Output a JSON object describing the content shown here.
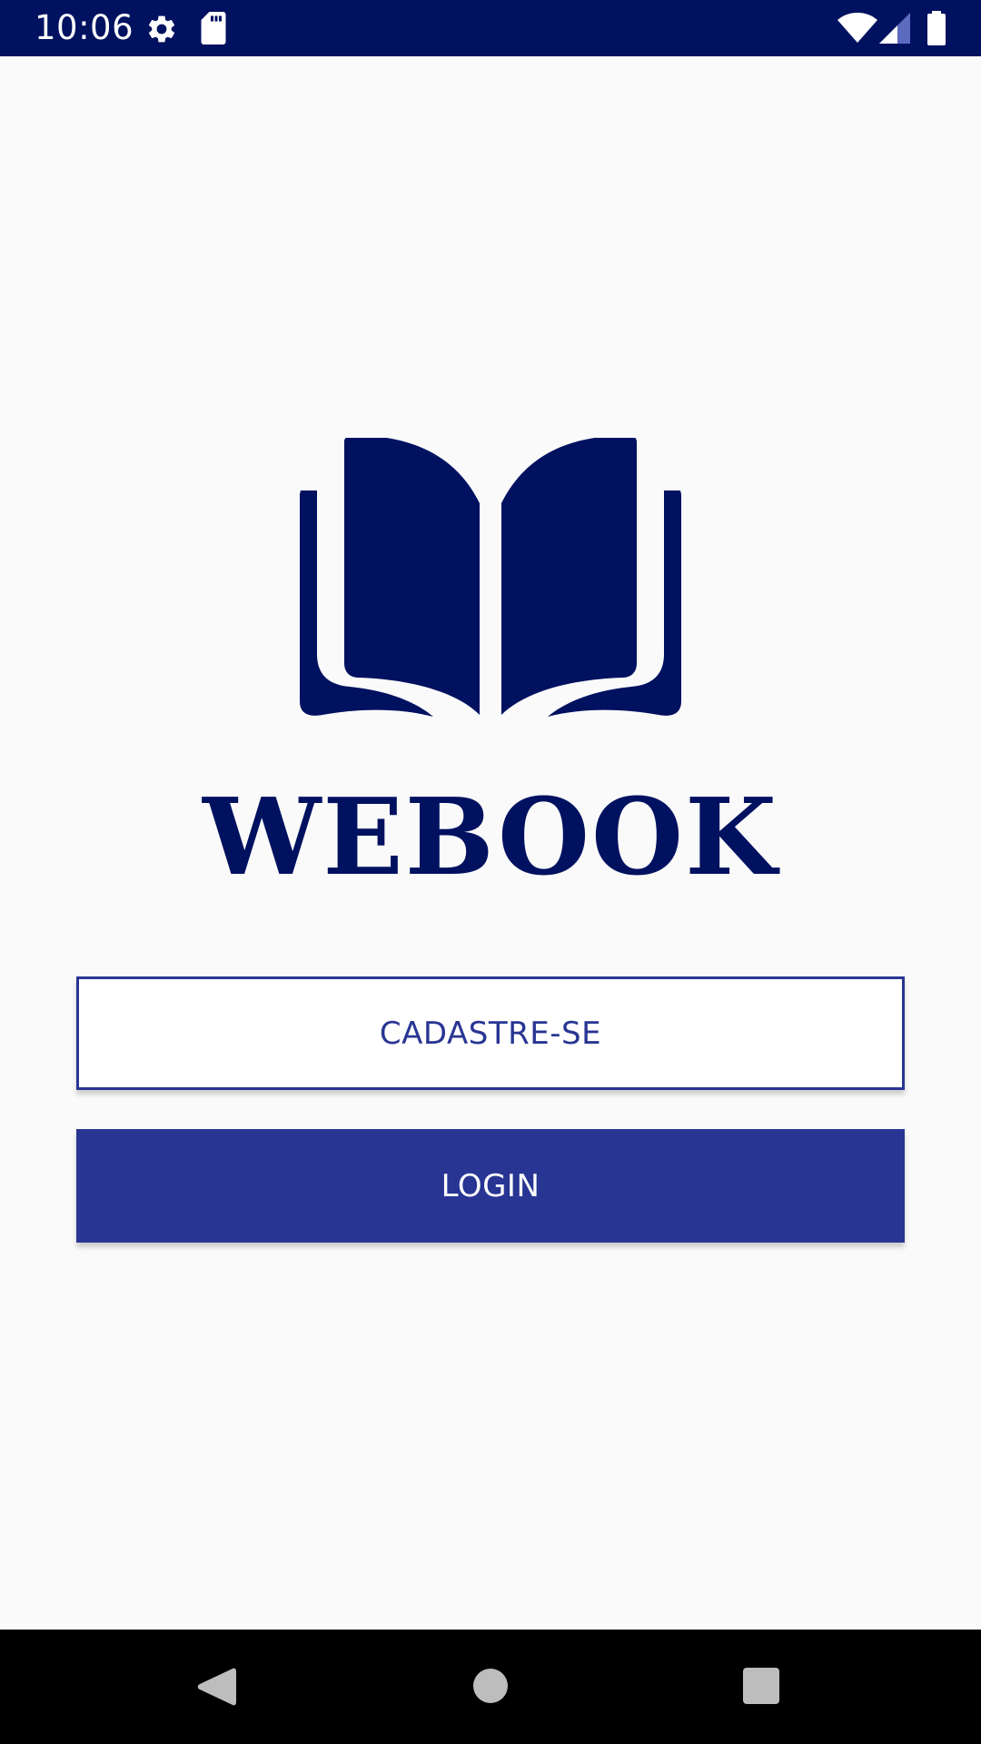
{
  "status_bar": {
    "time": "10:06",
    "icons": [
      "settings-icon",
      "sd-card-icon",
      "wifi-icon",
      "signal-icon",
      "battery-icon"
    ]
  },
  "logo": {
    "icon": "open-book-icon",
    "app_name": "WEBOOK"
  },
  "actions": {
    "register_label": "CADASTRE-SE",
    "login_label": "LOGIN"
  },
  "navigation_bar": {
    "icons": [
      "back-icon",
      "home-icon",
      "recents-icon"
    ]
  },
  "colors": {
    "status_bar": "#001160",
    "brand_navy": "#001160",
    "primary": "#283593",
    "background": "#fafafa"
  }
}
